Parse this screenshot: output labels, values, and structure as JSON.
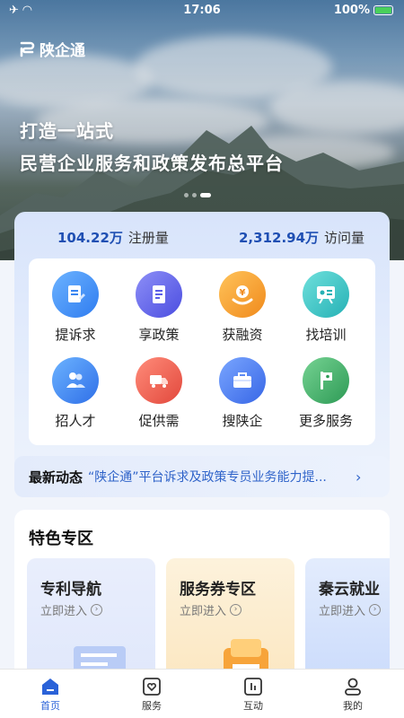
{
  "status_bar": {
    "time": "17:06",
    "battery": "100%"
  },
  "app": {
    "logo_text": "陕企通"
  },
  "hero": {
    "line1": "打造一站式",
    "line2": "民营企业服务和政策发布总平台"
  },
  "stats": [
    {
      "value": "104.22万",
      "label": "注册量"
    },
    {
      "value": "2,312.94万",
      "label": "访问量"
    }
  ],
  "services": [
    {
      "label": "提诉求",
      "icon": "document-edit-icon",
      "color": "#3e8ef7"
    },
    {
      "label": "享政策",
      "icon": "policy-document-icon",
      "color": "#5b5ee8"
    },
    {
      "label": "获融资",
      "icon": "finance-yuan-icon",
      "color": "#f5a623"
    },
    {
      "label": "找培训",
      "icon": "training-board-icon",
      "color": "#33c2c2"
    },
    {
      "label": "招人才",
      "icon": "talent-people-icon",
      "color": "#3e8ef7"
    },
    {
      "label": "促供需",
      "icon": "supply-truck-icon",
      "color": "#ee5a4f"
    },
    {
      "label": "搜陕企",
      "icon": "briefcase-icon",
      "color": "#4f7df0"
    },
    {
      "label": "更多服务",
      "icon": "more-flag-icon",
      "color": "#3fae64"
    }
  ],
  "news": {
    "title": "最新动态",
    "text": "“陕企通”平台诉求及政策专员业务能力提..."
  },
  "featured": {
    "title": "特色专区",
    "cards": [
      {
        "title": "专利导航",
        "sub": "立即进入"
      },
      {
        "title": "服务券专区",
        "sub": "立即进入"
      },
      {
        "title": "秦云就业",
        "sub": "立即进入"
      }
    ]
  },
  "tabs": [
    {
      "label": "首页",
      "icon": "home-icon"
    },
    {
      "label": "服务",
      "icon": "service-heart-icon"
    },
    {
      "label": "互动",
      "icon": "interaction-icon"
    },
    {
      "label": "我的",
      "icon": "profile-icon"
    }
  ]
}
